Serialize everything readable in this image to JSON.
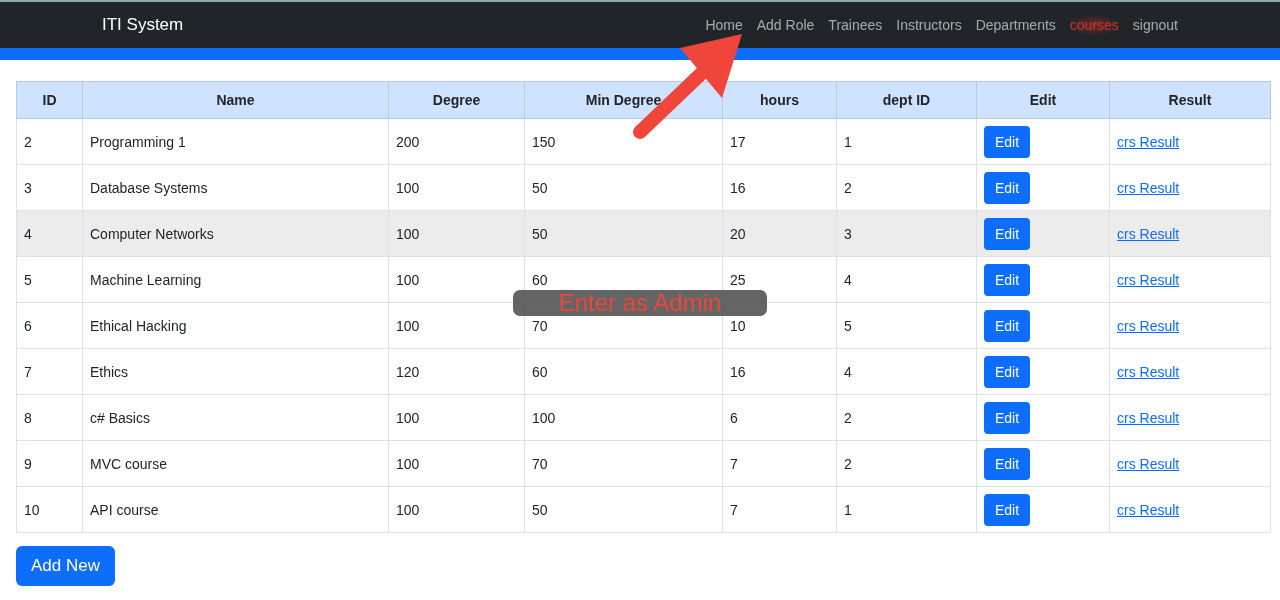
{
  "navbar": {
    "brand": "ITI System",
    "items": [
      {
        "label": "Home",
        "selected": false
      },
      {
        "label": "Add Role",
        "selected": false
      },
      {
        "label": "Trainees",
        "selected": false
      },
      {
        "label": "Instructors",
        "selected": false
      },
      {
        "label": "Departments",
        "selected": false
      },
      {
        "label": "courses",
        "selected": true
      },
      {
        "label": "signout",
        "selected": false
      }
    ]
  },
  "table": {
    "columns": [
      "ID",
      "Name",
      "Degree",
      "Min Degree",
      "hours",
      "dept ID",
      "Edit",
      "Result"
    ],
    "rows": [
      {
        "cells": [
          "2",
          "Programming 1",
          "200",
          "150",
          "17",
          "1"
        ],
        "button": "Edit",
        "link": "crs Result",
        "selected": false
      },
      {
        "cells": [
          "3",
          "Database Systems",
          "100",
          "50",
          "16",
          "2"
        ],
        "button": "Edit",
        "link": "crs Result",
        "selected": false
      },
      {
        "cells": [
          "4",
          "Computer Networks",
          "100",
          "50",
          "20",
          "3"
        ],
        "button": "Edit",
        "link": "crs Result",
        "selected": true
      },
      {
        "cells": [
          "5",
          "Machine Learning",
          "100",
          "60",
          "25",
          "4"
        ],
        "button": "Edit",
        "link": "crs Result",
        "selected": false
      },
      {
        "cells": [
          "6",
          "Ethical Hacking",
          "100",
          "70",
          "10",
          "5"
        ],
        "button": "Edit",
        "link": "crs Result",
        "selected": false
      },
      {
        "cells": [
          "7",
          "Ethics",
          "120",
          "60",
          "16",
          "4"
        ],
        "button": "Edit",
        "link": "crs Result",
        "selected": false
      },
      {
        "cells": [
          "8",
          "c# Basics",
          "100",
          "100",
          "6",
          "2"
        ],
        "button": "Edit",
        "link": "crs Result",
        "selected": false
      },
      {
        "cells": [
          "9",
          "MVC course",
          "100",
          "70",
          "7",
          "2"
        ],
        "button": "Edit",
        "link": "crs Result",
        "selected": false
      },
      {
        "cells": [
          "10",
          "API course",
          "100",
          "50",
          "7",
          "1"
        ],
        "button": "Edit",
        "link": "crs Result",
        "selected": false
      }
    ]
  },
  "add_button": "Add New",
  "annotation": {
    "label": "Enter as Admin"
  }
}
